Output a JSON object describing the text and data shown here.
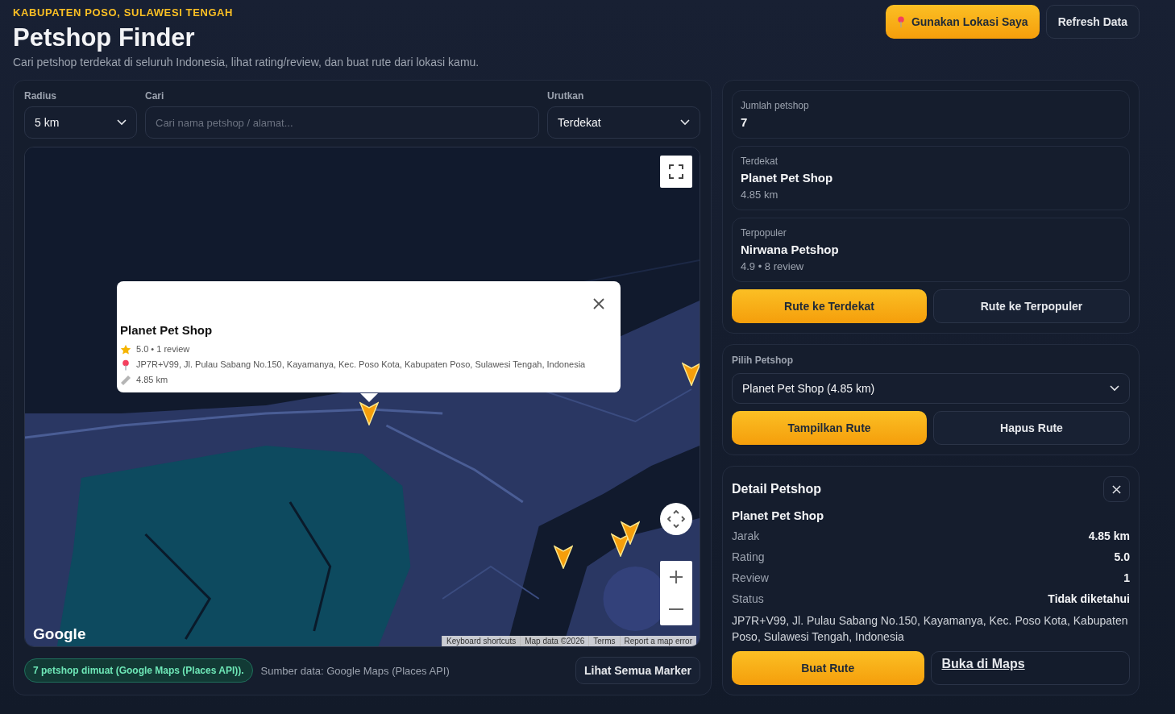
{
  "header": {
    "eyebrow": "KABUPATEN POSO, SULAWESI TENGAH",
    "title": "Petshop Finder",
    "subtitle": "Cari petshop terdekat di seluruh Indonesia, lihat rating/review, dan buat rute dari lokasi kamu."
  },
  "header_buttons": [
    {
      "label": "Gunakan Lokasi Saya",
      "kind": "primary"
    },
    {
      "label": "Refresh Data",
      "kind": "secondary"
    }
  ],
  "filters": {
    "radius": {
      "label": "Radius",
      "value": "5 km"
    },
    "search": {
      "label": "Cari",
      "placeholder": "Cari nama petshop / alamat..."
    },
    "sort": {
      "label": "Urutkan",
      "value": "Terdekat"
    }
  },
  "map": {
    "popup": {
      "name": "Planet Pet Shop",
      "rating_line": "5.0 • 1 review",
      "address": "JP7R+V99, Jl. Pulau Sabang No.150, Kayamanya, Kec. Poso Kota, Kabupaten Poso, Sulawesi Tengah, Indonesia",
      "distance": "4.85 km"
    },
    "logo": "Google",
    "attribution": [
      "Keyboard shortcuts",
      "Map data ©2026",
      "Terms",
      "Report a map error"
    ]
  },
  "map_footer": {
    "status": "7 petshop dimuat (Google Maps (Places API)).",
    "source": "Sumber data: Google Maps (Places API)",
    "button": "Lihat Semua Marker"
  },
  "stats": [
    {
      "label": "Jumlah petshop",
      "value": "7"
    },
    {
      "label": "Terdekat",
      "value": "Planet Pet Shop",
      "sub": "4.85 km"
    },
    {
      "label": "Terpopuler",
      "value": "Nirwana Petshop",
      "sub": "4.9 • 8 review"
    }
  ],
  "route_buttons": [
    {
      "label": "Rute ke Terdekat",
      "kind": "primary"
    },
    {
      "label": "Rute ke Terpopuler",
      "kind": "secondary"
    }
  ],
  "picker": {
    "label": "Pilih Petshop",
    "value": "Planet Pet Shop (4.85 km)"
  },
  "picker_buttons": [
    {
      "label": "Tampilkan Rute",
      "kind": "primary"
    },
    {
      "label": "Hapus Rute",
      "kind": "secondary"
    }
  ],
  "detail": {
    "title": "Detail Petshop",
    "name": "Planet Pet Shop",
    "rows": [
      {
        "label": "Jarak",
        "value": "4.85 km"
      },
      {
        "label": "Rating",
        "value": "5.0"
      },
      {
        "label": "Review",
        "value": "1"
      },
      {
        "label": "Status",
        "value": "Tidak diketahui"
      }
    ],
    "address": "JP7R+V99, Jl. Pulau Sabang No.150, Kayamanya, Kec. Poso Kota, Kabupaten Poso, Sulawesi Tengah, Indonesia",
    "buttons": [
      {
        "label": "Buat Rute",
        "kind": "primary"
      },
      {
        "label": "Buka di Maps",
        "kind": "link"
      }
    ]
  }
}
